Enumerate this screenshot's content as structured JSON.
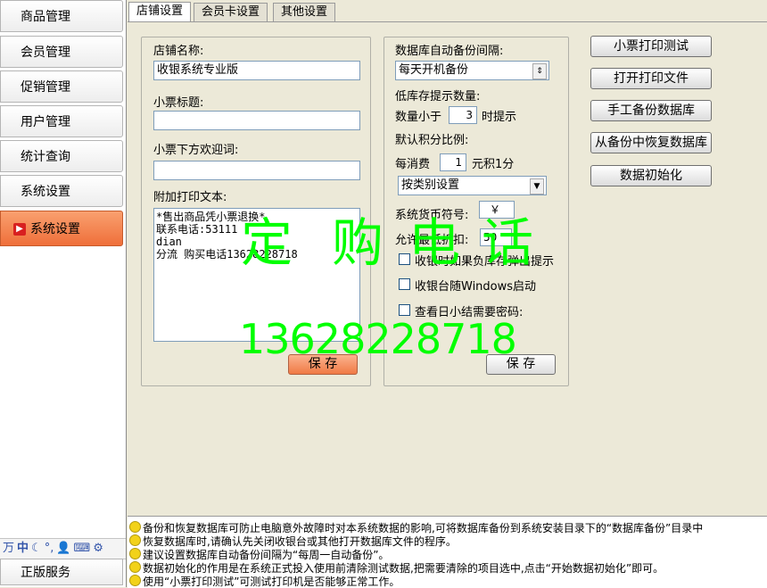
{
  "sidebar": {
    "items": [
      {
        "label": "商品管理"
      },
      {
        "label": "会员管理"
      },
      {
        "label": "促销管理"
      },
      {
        "label": "用户管理"
      },
      {
        "label": "统计查询"
      },
      {
        "label": "系统设置"
      }
    ],
    "active_label": "系统设置",
    "ime": {
      "mode": "中",
      "icons": [
        "ime-logo-icon",
        "moon-icon",
        "degree-icon",
        "user-icon",
        "keyboard-icon",
        "settings-icon"
      ]
    },
    "bottom_label": "正版服务"
  },
  "tabs": [
    {
      "label": "店铺设置",
      "active": true
    },
    {
      "label": "会员卡设置",
      "active": false
    },
    {
      "label": "其他设置",
      "active": false
    }
  ],
  "shop": {
    "name_label": "店铺名称:",
    "name_value": "收银系统专业版",
    "receipt_title_label": "小票标题:",
    "receipt_title_value": "",
    "welcome_label": "小票下方欢迎词:",
    "welcome_value": "",
    "extra_text_label": "附加打印文本:",
    "extra_text_value": "*售出商品凭小票退换*\n联系电话:53111\ndian\n分流 购买电话13628228718",
    "save_label": "保 存"
  },
  "db": {
    "backup_label": "数据库自动备份间隔:",
    "backup_value": "每天开机备份",
    "low_stock_label": "低库存提示数量:",
    "qty_less_label": "数量小于",
    "qty_value": "3",
    "qty_suffix": "时提示",
    "points_label": "默认积分比例:",
    "spend_label": "每消费",
    "spend_value": "1",
    "spend_suffix": "元积1分",
    "category_value": "按类别设置",
    "currency_label": "系统货币符号:",
    "currency_value": "￥",
    "discount_label": "允许最低折扣:",
    "discount_value": "50",
    "checks": [
      {
        "label": "收银时如果负库存弹出提示",
        "checked": false
      },
      {
        "label": "收银台随Windows启动",
        "checked": false
      },
      {
        "label": "查看日小结需要密码:",
        "checked": false
      }
    ],
    "save_label": "保 存"
  },
  "actions": [
    {
      "label": "小票打印测试"
    },
    {
      "label": "打开打印文件"
    },
    {
      "label": "手工备份数据库"
    },
    {
      "label": "从备份中恢复数据库"
    },
    {
      "label": "数据初始化"
    }
  ],
  "watermark": {
    "chars": [
      "定",
      "购",
      "电",
      "话"
    ],
    "phone": "13628228718",
    "color": "#00ff00"
  },
  "info_lines": [
    "备份和恢复数据库可防止电脑意外故障时对本系统数据的影响,可将数据库备份到系统安装目录下的“数据库备份”目录中",
    "恢复数据库时,请确认先关闭收银台或其他打开数据库文件的程序。",
    "建议设置数据库自动备份间隔为“每周一自动备份”。",
    "数据初始化的作用是在系统正式投入使用前清除测试数据,把需要清除的项目选中,点击“开始数据初始化”即可。",
    "使用“小票打印测试”可测试打印机是否能够正常工作。"
  ]
}
